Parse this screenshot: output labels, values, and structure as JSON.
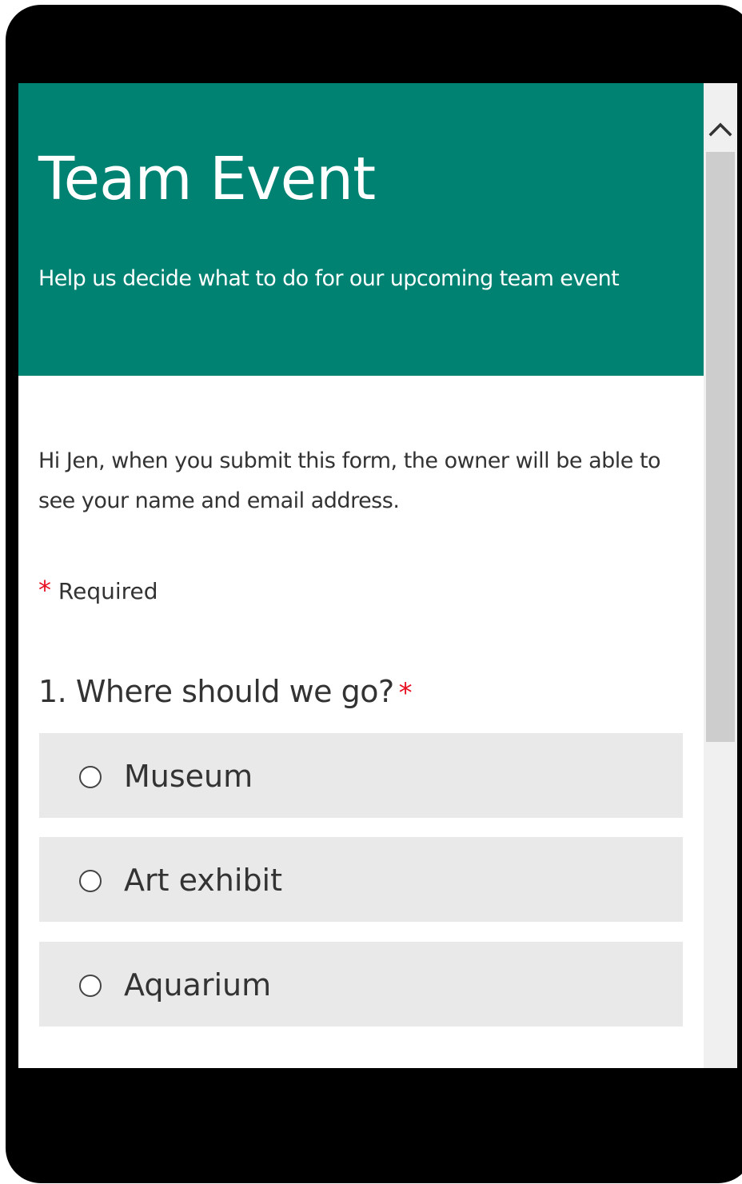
{
  "form": {
    "title": "Team Event",
    "subtitle": "Help us decide what to do for our upcoming team event",
    "notice": "Hi Jen, when you submit this form, the owner will be able to see your name and email address.",
    "required_star": "*",
    "required_label": "Required"
  },
  "questions": [
    {
      "number_and_text": "1. Where should we go?",
      "required_star": "*",
      "options": [
        {
          "label": "Museum",
          "selected": false
        },
        {
          "label": "Art exhibit",
          "selected": false
        },
        {
          "label": "Aquarium",
          "selected": false
        }
      ]
    }
  ],
  "theme": {
    "header_color": "#008272",
    "required_color": "#e81123",
    "option_background": "#e9e9e9"
  },
  "icons": {
    "scroll_up": "chevron-up-icon",
    "radio": "radio-empty-icon"
  }
}
